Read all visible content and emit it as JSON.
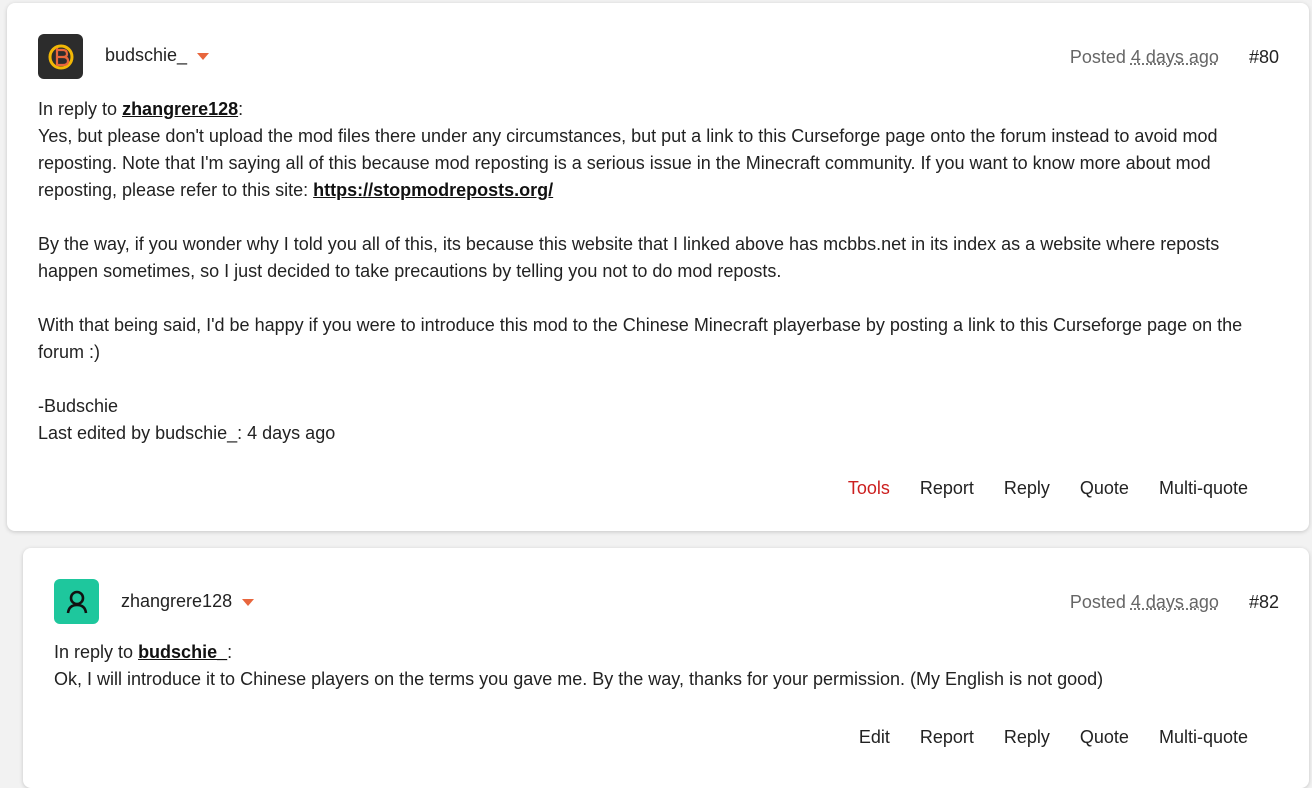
{
  "posts": [
    {
      "author": "budschie_",
      "posted_prefix": "Posted",
      "posted_ago": "4 days ago",
      "number": "#80",
      "reply_prefix": "In reply to",
      "reply_to": "zhangrere128",
      "reply_suffix": ":",
      "para1": " Yes, but please don't upload the mod files there under any circumstances, but put a link to this Curseforge page onto the forum instead to avoid mod reposting. Note that I'm saying all of this because mod reposting is a serious issue in the Minecraft community. If you want to know more about mod reposting, please refer to this site: ",
      "link": "https://stopmodreposts.org/",
      "para2": "By the way, if you wonder why I told you all of this, its because this website that I linked above has mcbbs.net in its index as a website where reposts happen sometimes, so I just decided to take precautions by telling you not to do mod reposts.",
      "para3": "With that being said, I'd be happy if you were to introduce this mod to the Chinese Minecraft playerbase by posting a link to this Curseforge page on the forum :)",
      "sign": "-Budschie",
      "edited": "Last edited by budschie_: 4 days ago",
      "actions": [
        "Tools",
        "Report",
        "Reply",
        "Quote",
        "Multi-quote"
      ],
      "avatar_icon": "b-logo-icon"
    },
    {
      "author": "zhangrere128",
      "posted_prefix": "Posted",
      "posted_ago": "4 days ago",
      "number": "#82",
      "reply_prefix": "In reply to",
      "reply_to": "budschie_",
      "reply_suffix": ":",
      "para1": " Ok, I will introduce it to Chinese players on the terms you gave me. By the way, thanks for your permission. (My English is not good)",
      "actions": [
        "Edit",
        "Report",
        "Reply",
        "Quote",
        "Multi-quote"
      ],
      "avatar_icon": "person-icon"
    }
  ],
  "colors": {
    "tools_red": "#cc1f1f",
    "caret_orange": "#e8663d",
    "avatar2_teal": "#1ec79d"
  }
}
